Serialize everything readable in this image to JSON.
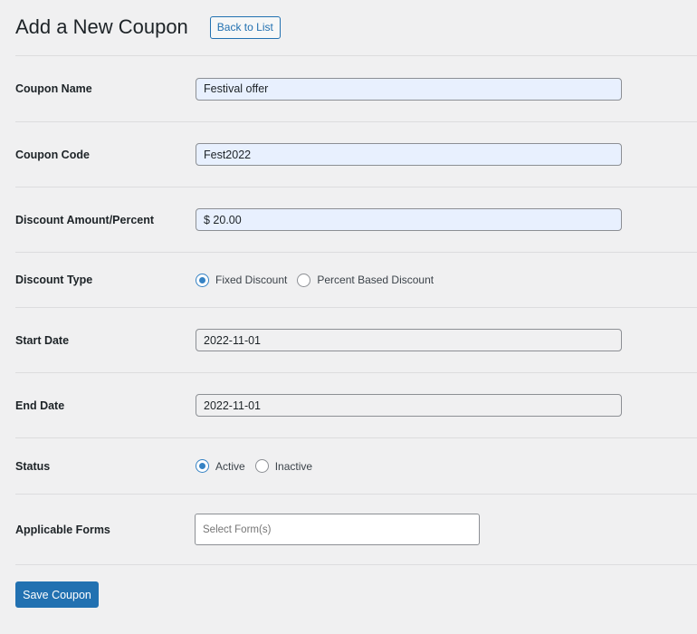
{
  "header": {
    "title": "Add a New Coupon",
    "back_label": "Back to List"
  },
  "form": {
    "coupon_name": {
      "label": "Coupon Name",
      "value": "Festival offer"
    },
    "coupon_code": {
      "label": "Coupon Code",
      "value": "Fest2022"
    },
    "discount_amount": {
      "label": "Discount Amount/Percent",
      "value": "$ 20.00"
    },
    "discount_type": {
      "label": "Discount Type",
      "options": [
        {
          "label": "Fixed Discount",
          "checked": true
        },
        {
          "label": "Percent Based Discount",
          "checked": false
        }
      ]
    },
    "start_date": {
      "label": "Start Date",
      "value": "2022-11-01"
    },
    "end_date": {
      "label": "End Date",
      "value": "2022-11-01"
    },
    "status": {
      "label": "Status",
      "options": [
        {
          "label": "Active",
          "checked": true
        },
        {
          "label": "Inactive",
          "checked": false
        }
      ]
    },
    "applicable_forms": {
      "label": "Applicable Forms",
      "placeholder": "Select Form(s)"
    }
  },
  "actions": {
    "save_label": "Save Coupon"
  },
  "colors": {
    "accent": "#2271b1",
    "background": "#f0f0f1",
    "autofill": "#e8f0fe",
    "radio_checked": "#3582c4"
  }
}
